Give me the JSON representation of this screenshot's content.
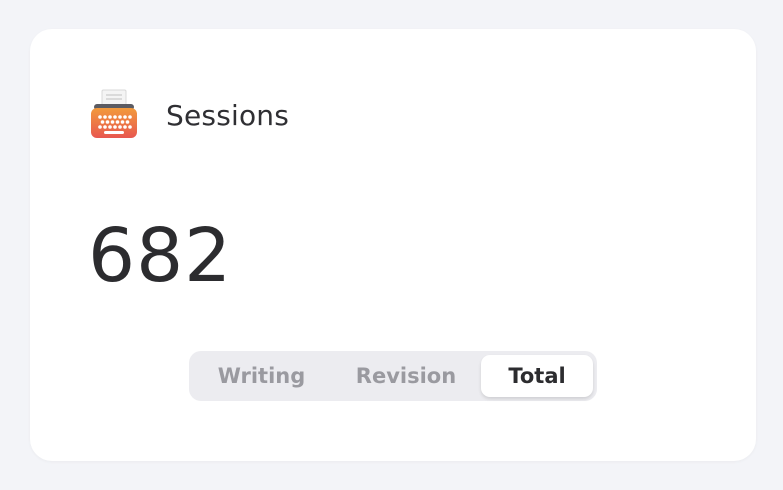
{
  "card": {
    "title": "Sessions",
    "icon": "typewriter-icon",
    "value": "682"
  },
  "segmented": {
    "options": [
      {
        "label": "Writing",
        "selected": false
      },
      {
        "label": "Revision",
        "selected": false
      },
      {
        "label": "Total",
        "selected": true
      }
    ]
  },
  "colors": {
    "background": "#f3f4f8",
    "card": "#ffffff",
    "text_primary": "#2c2c2f",
    "text_muted": "#9a9aa0",
    "segment_track": "#ececf0",
    "icon_orange": "#f08a3a",
    "icon_red": "#e85a4f"
  }
}
